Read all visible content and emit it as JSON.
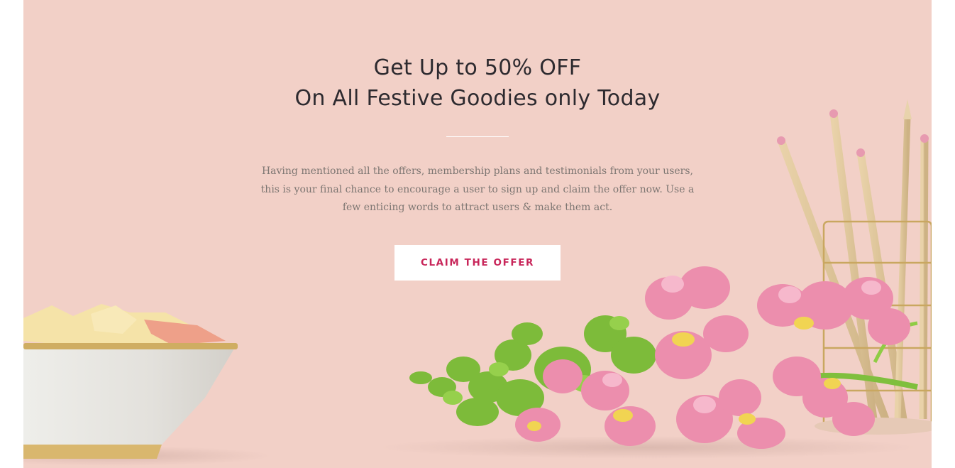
{
  "hero": {
    "headline_line1": "Get Up to 50% OFF",
    "headline_line2": "On All Festive Goodies only Today",
    "description": "Having mentioned all the offers, membership plans and testimonials from your users, this is your final chance to encourage a user to sign up and claim the offer now. Use a few enticing words to attract users & make them act.",
    "cta_label": "CLAIM THE OFFER"
  },
  "colors": {
    "background": "#f2d0c7",
    "headline": "#2d2a2f",
    "body_text": "#7d7672",
    "cta_text": "#c8265a",
    "cta_bg": "#ffffff"
  },
  "images": [
    "bowl-illustration",
    "flower-bouquet-illustration",
    "pencil-cup-illustration"
  ]
}
